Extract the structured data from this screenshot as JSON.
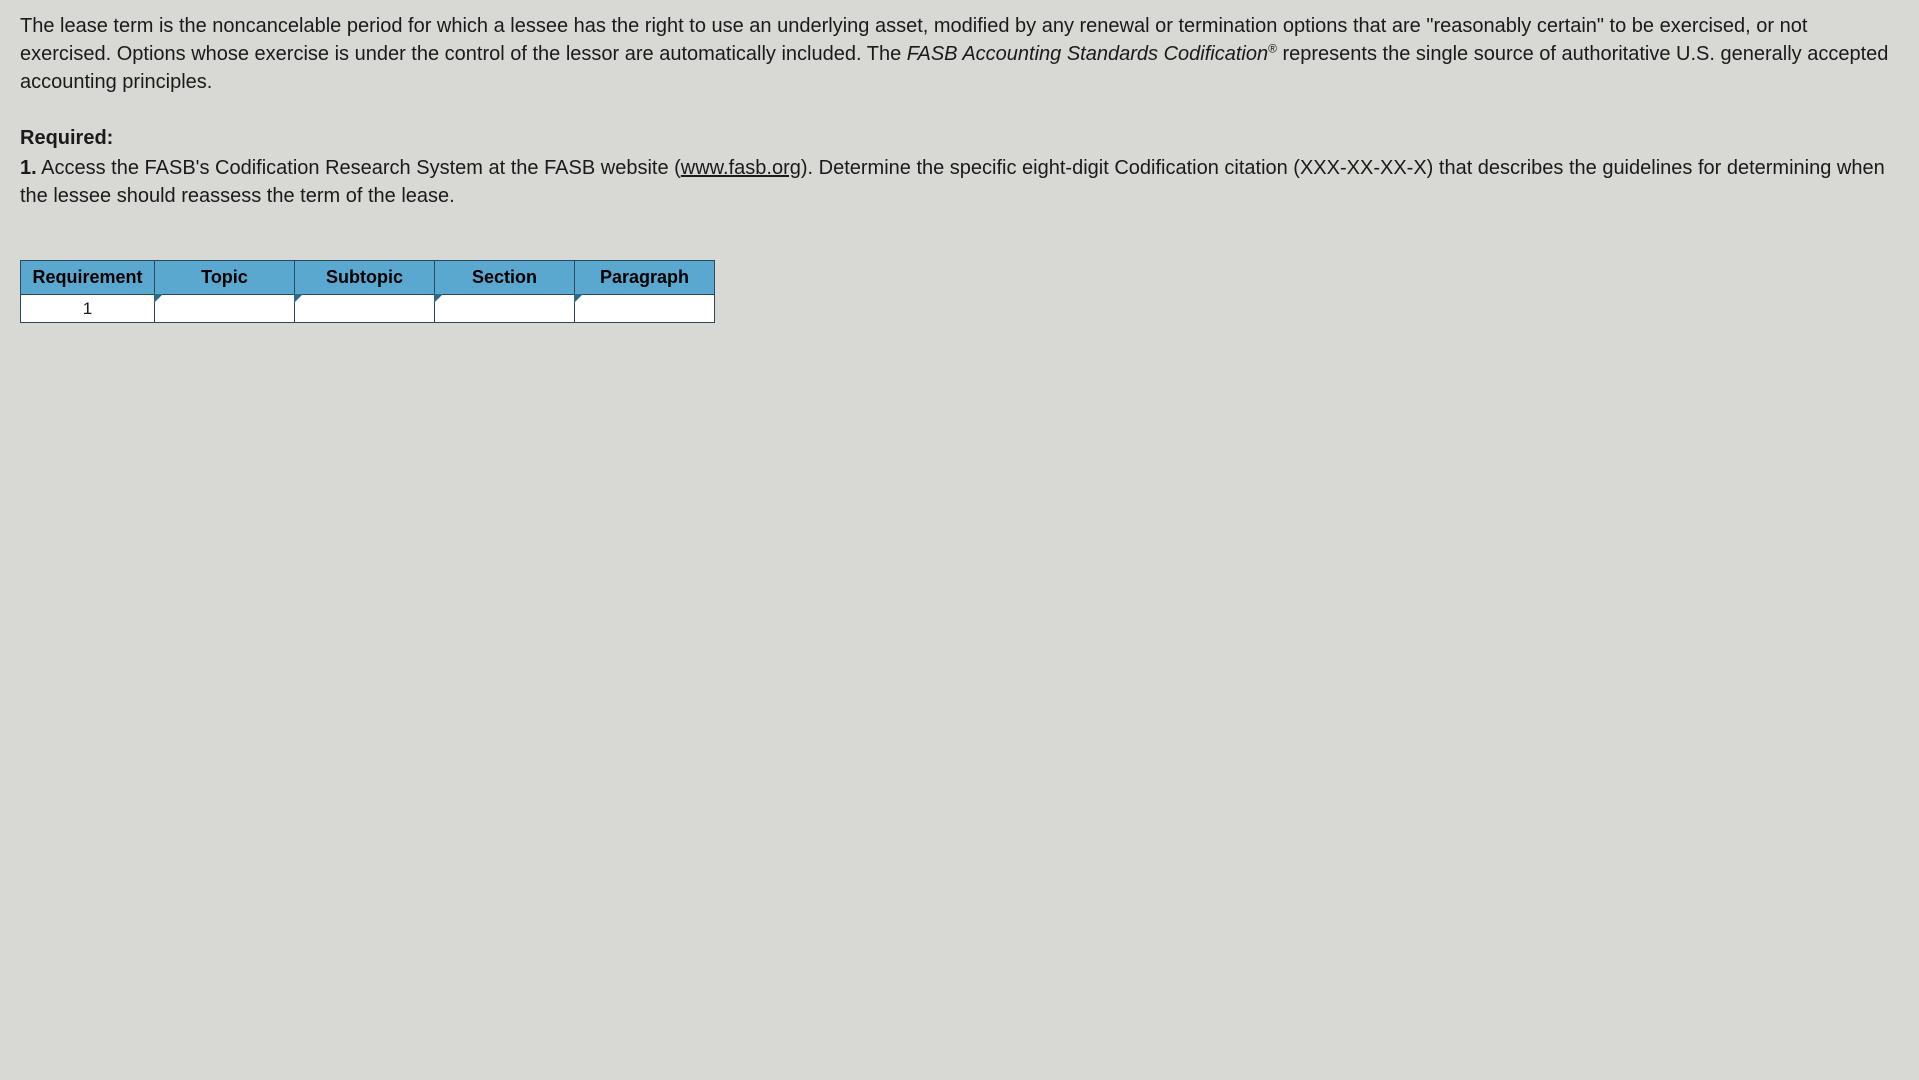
{
  "intro": {
    "part1": "The lease term is the noncancelable period for which a lessee has the right to use an underlying asset, modified by any renewal or termination options that are \"reasonably certain\" to be exercised, or not exercised. Options whose exercise is under the control of the lessor are automatically included. The ",
    "italic": "FASB Accounting Standards Codification",
    "reg": "®",
    "part2": " represents the single source of authoritative U.S. generally accepted accounting principles."
  },
  "required": {
    "label": "Required:",
    "num": "1.",
    "text_before_link": " Access the FASB's Codification Research System at the FASB website (",
    "link_text": "www.fasb.org",
    "text_after_link": "). Determine the specific eight-digit Codification citation (XXX-XX-XX-X) that describes the guidelines for determining when the lessee should reassess the term of the lease."
  },
  "table": {
    "headers": {
      "requirement": "Requirement",
      "topic": "Topic",
      "subtopic": "Subtopic",
      "section": "Section",
      "paragraph": "Paragraph"
    },
    "rows": [
      {
        "requirement": "1",
        "topic": "",
        "subtopic": "",
        "section": "",
        "paragraph": ""
      }
    ]
  }
}
